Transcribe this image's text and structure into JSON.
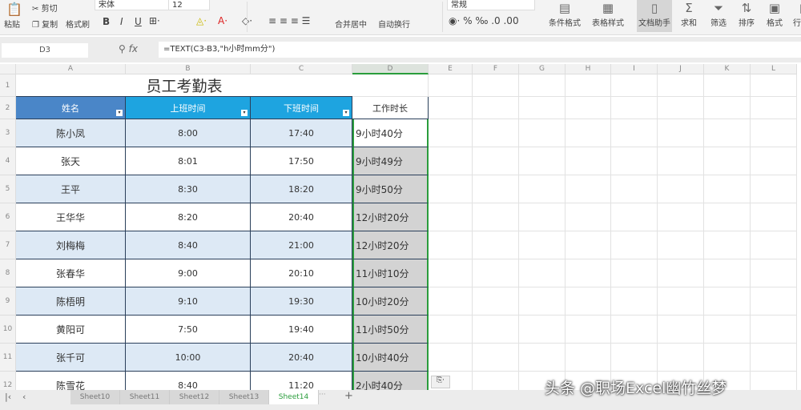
{
  "ribbon": {
    "paste": "粘贴",
    "cut": "剪切",
    "copy": "复制",
    "format_painter": "格式刷",
    "font_name": "宋体",
    "font_size": "12",
    "merge_center": "合并居中",
    "wrap_text": "自动换行",
    "number_format": "常规",
    "conditional_format": "条件格式",
    "table_style": "表格样式",
    "doc_helper": "文档助手",
    "sum": "求和",
    "filter": "筛选",
    "sort": "排序",
    "format": "格式",
    "rows_cols": "行和列"
  },
  "formula_bar": {
    "cell_ref": "D3",
    "fx": "fx",
    "formula": "=TEXT(C3-B3,\"h小时mm分\")"
  },
  "columns": [
    "A",
    "B",
    "C",
    "D",
    "E",
    "F",
    "G",
    "H",
    "I",
    "J",
    "K",
    "L"
  ],
  "rows": [
    "1",
    "2",
    "3",
    "4",
    "5",
    "6",
    "7",
    "8",
    "9",
    "10",
    "11",
    "12"
  ],
  "table": {
    "title": "员工考勤表",
    "headers": [
      "姓名",
      "上班时间",
      "下班时间",
      "工作时长"
    ],
    "records": [
      [
        "陈小凤",
        "8:00",
        "17:40",
        "9小时40分"
      ],
      [
        "张天",
        "8:01",
        "17:50",
        "9小时49分"
      ],
      [
        "王平",
        "8:30",
        "18:20",
        "9小时50分"
      ],
      [
        "王华华",
        "8:20",
        "20:40",
        "12小时20分"
      ],
      [
        "刘梅梅",
        "8:40",
        "21:00",
        "12小时20分"
      ],
      [
        "张春华",
        "9:00",
        "20:10",
        "11小时10分"
      ],
      [
        "陈梧明",
        "9:10",
        "19:30",
        "10小时20分"
      ],
      [
        "黄阳可",
        "7:50",
        "19:40",
        "11小时50分"
      ],
      [
        "张千可",
        "10:00",
        "20:40",
        "10小时40分"
      ],
      [
        "陈雪花",
        "8:40",
        "11:20",
        "2小时40分"
      ]
    ]
  },
  "sheet_tabs": [
    "Sheet10",
    "Sheet11",
    "Sheet12",
    "Sheet13",
    "Sheet14"
  ],
  "active_sheet": "Sheet14",
  "paste_options": "⎘·",
  "watermark": "头条 @职场Excel幽竹丝梦",
  "colors": {
    "header_name": "#4a86c8",
    "header_time": "#1ea4e0",
    "row_alt": "#dde9f5",
    "duration_fill": "#d3d3d3",
    "selection": "#2a9d3c"
  }
}
